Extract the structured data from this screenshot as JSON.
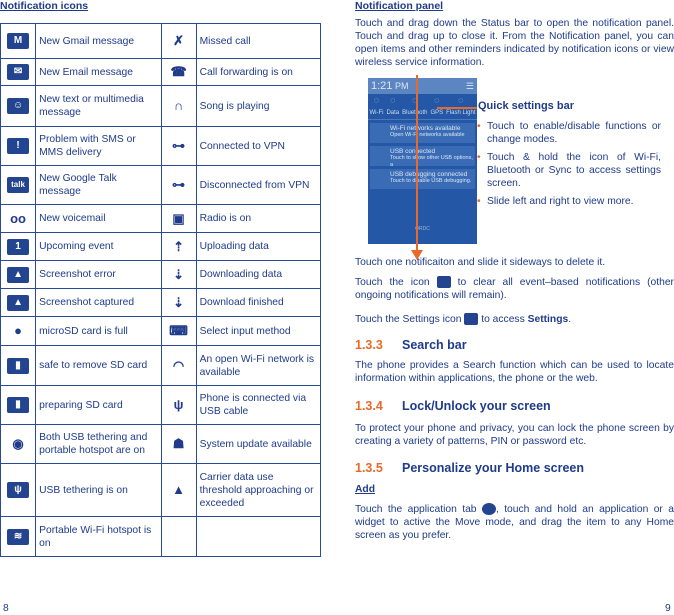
{
  "left": {
    "title": "Notification icons",
    "page_number": "8",
    "rows": [
      {
        "icon1": "gmail-icon",
        "label1": "New Gmail message",
        "icon2": "missed-call-icon",
        "label2": "Missed call"
      },
      {
        "icon1": "email-icon",
        "label1": "New Email message",
        "icon2": "call-forwarding-icon",
        "label2": "Call forwarding is on"
      },
      {
        "icon1": "sms-smiley-icon",
        "label1": "New text or multimedia message",
        "icon2": "headphones-icon",
        "label2": "Song is playing"
      },
      {
        "icon1": "sms-error-icon",
        "label1": "Problem with SMS or MMS delivery",
        "icon2": "vpn-key-icon",
        "label2": "Connected to VPN"
      },
      {
        "icon1": "talk-icon",
        "label1": "New Google Talk message",
        "icon2": "vpn-key-icon",
        "label2": "Disconnected from VPN"
      },
      {
        "icon1": "voicemail-icon",
        "label1": "New voicemail",
        "icon2": "radio-icon",
        "label2": "Radio is on"
      },
      {
        "icon1": "calendar-icon",
        "label1": "Upcoming event",
        "icon2": "upload-icon",
        "label2": "Uploading data"
      },
      {
        "icon1": "screenshot-error-icon",
        "label1": "Screenshot error",
        "icon2": "download-icon",
        "label2": "Downloading data"
      },
      {
        "icon1": "screenshot-icon",
        "label1": " Screenshot captured",
        "icon2": "download-done-icon",
        "label2": "Download finished"
      },
      {
        "icon1": "sd-full-icon",
        "label1": "microSD card is full",
        "icon2": "keyboard-icon",
        "label2": "Select input method"
      },
      {
        "icon1": "sd-remove-icon",
        "label1": "safe to remove SD card",
        "icon2": "wifi-icon",
        "label2": "An open Wi-Fi network is available"
      },
      {
        "icon1": "sd-prepare-icon",
        "label1": "preparing SD card",
        "icon2": "usb-icon",
        "label2": "Phone is connected via USB cable"
      },
      {
        "icon1": "hotspot-usb-icon",
        "label1": "Both USB tethering and portable hotspot are on",
        "icon2": "android-icon",
        "label2": "System update available"
      },
      {
        "icon1": "usb-tether-icon",
        "label1": "USB tethering is on",
        "icon2": "warning-icon",
        "label2": "Carrier data use threshold approaching or exceeded"
      },
      {
        "icon1": "wifi-hotspot-icon",
        "label1": "Portable Wi-Fi hotspot is on",
        "icon2": "",
        "label2": ""
      }
    ]
  },
  "right": {
    "title": "Notification panel",
    "page_number": "9",
    "intro": "Touch and drag down the Status bar to open the notification panel. Touch and drag up to close it. From the Notification panel, you can open items and other reminders indicated by notification icons or view wireless service information.",
    "phone": {
      "time": "1:21",
      "ampm": "PM",
      "quick": [
        "Wi-Fi",
        "Data",
        "Bluetooth",
        "GPS",
        "Flash Light"
      ],
      "notifs": [
        {
          "title": "Wi-Fi networks available",
          "sub": "Open Wi-Fi networks available"
        },
        {
          "title": "USB connected",
          "sub": "Touch to show other USB options, a"
        },
        {
          "title": "USB debugging connected",
          "sub": "Touch to disable USB debugging."
        }
      ],
      "carrier": "ORDC"
    },
    "callout": "Quick settings bar",
    "bullets": [
      "Touch to enable/disable functions or change modes.",
      "Touch & hold the icon of Wi-Fi, Bluetooth or Sync to access settings screen.",
      "Slide left and right to view more."
    ],
    "p1": "Touch one notificaiton and slide it sideways to delete it.",
    "p2a": "Touch the icon",
    "p2b": "to clear all event–based notifications (other ongoing notifications will remain).",
    "p3a": "Touch the Settings icon",
    "p3b": "to access",
    "p3c": "Settings",
    "p3d": ".",
    "s1": {
      "num": "1.3.3",
      "title": "Search bar",
      "text": "The phone provides a Search function which can be used to locate information within applications, the phone or the web."
    },
    "s2": {
      "num": "1.3.4",
      "title": "Lock/Unlock your screen",
      "text": "To protect your phone and privacy, you can lock the phone screen by creating a variety of patterns, PIN or password etc."
    },
    "s3": {
      "num": "1.3.5",
      "title": "Personalize your Home screen",
      "sub": "Add",
      "text_a": "Touch the application tab",
      "text_b": ",  touch and hold an application or a widget to active the Move mode, and drag the item to any Home screen as you prefer."
    }
  },
  "colors": {
    "text": "#1f3b8a",
    "accent": "#e8692a"
  }
}
